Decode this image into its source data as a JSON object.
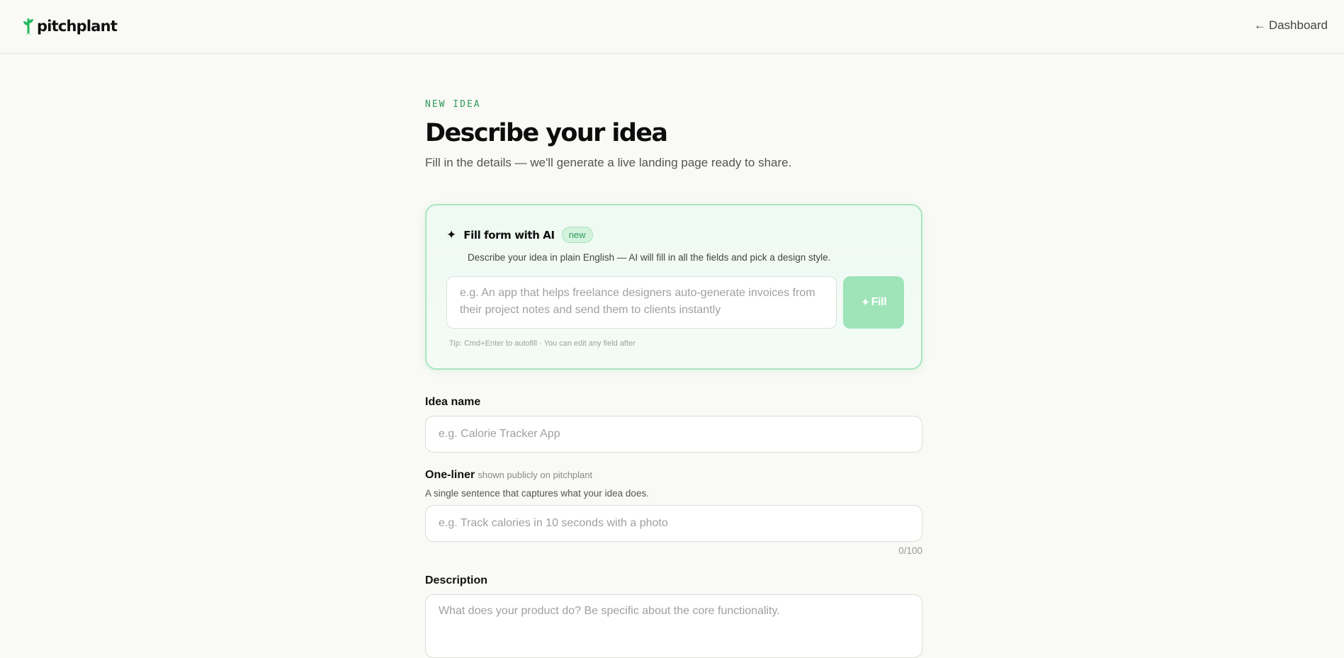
{
  "header": {
    "logo_text": "pitchplant",
    "dashboard_link": "Dashboard",
    "dashboard_arrow": "←"
  },
  "page": {
    "eyebrow": "NEW IDEA",
    "title": "Describe your idea",
    "subtitle": "Fill in the details — we'll generate a live landing page ready to share."
  },
  "ai_card": {
    "title": "Fill form with AI",
    "badge": "new",
    "description": "Describe your idea in plain English — AI will fill in all the fields and pick a design style.",
    "textarea_placeholder": "e.g. An app that helps freelance designers auto-generate invoices from their project notes and send them to clients instantly",
    "fill_button": "Fill",
    "tip": "Tip: Cmd+Enter to autofill · You can edit any field after",
    "colors": {
      "border": "#a9e6c0",
      "button": "#9fe3b9",
      "accent": "#2f9a5c"
    }
  },
  "form": {
    "idea_name": {
      "label": "Idea name",
      "placeholder": "e.g. Calorie Tracker App"
    },
    "one_liner": {
      "label": "One-liner",
      "hint": "shown publicly on pitchplant",
      "helper": "A single sentence that captures what your idea does.",
      "placeholder": "e.g. Track calories in 10 seconds with a photo",
      "counter": "0/100"
    },
    "description": {
      "label": "Description",
      "placeholder": "What does your product do? Be specific about the core functionality."
    }
  }
}
